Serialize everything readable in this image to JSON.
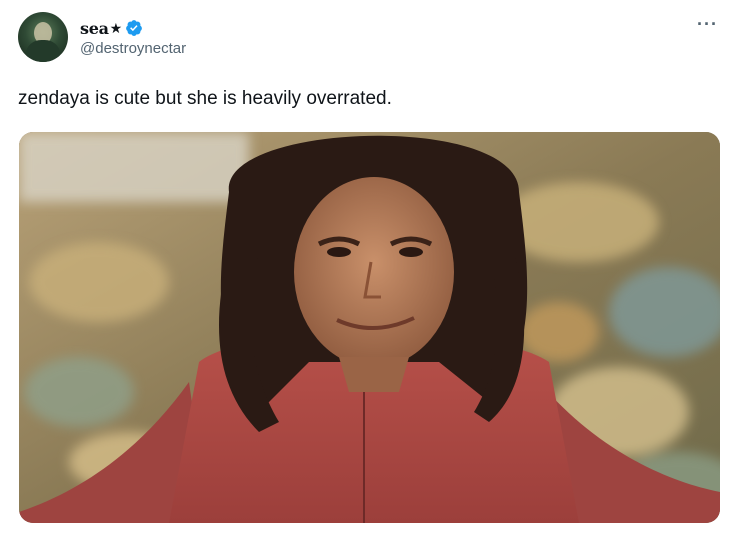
{
  "tweet": {
    "display_name": "sea",
    "name_emoji": "star-icon",
    "handle": "@destroynectar",
    "text": "zendaya is cute but she is heavily overrated.",
    "more_label": "···"
  },
  "icons": {
    "verified": "verified-badge-icon",
    "more": "more-options-icon"
  },
  "colors": {
    "text": "#0f1419",
    "secondary": "#536471",
    "verified": "#1d9bf0"
  }
}
